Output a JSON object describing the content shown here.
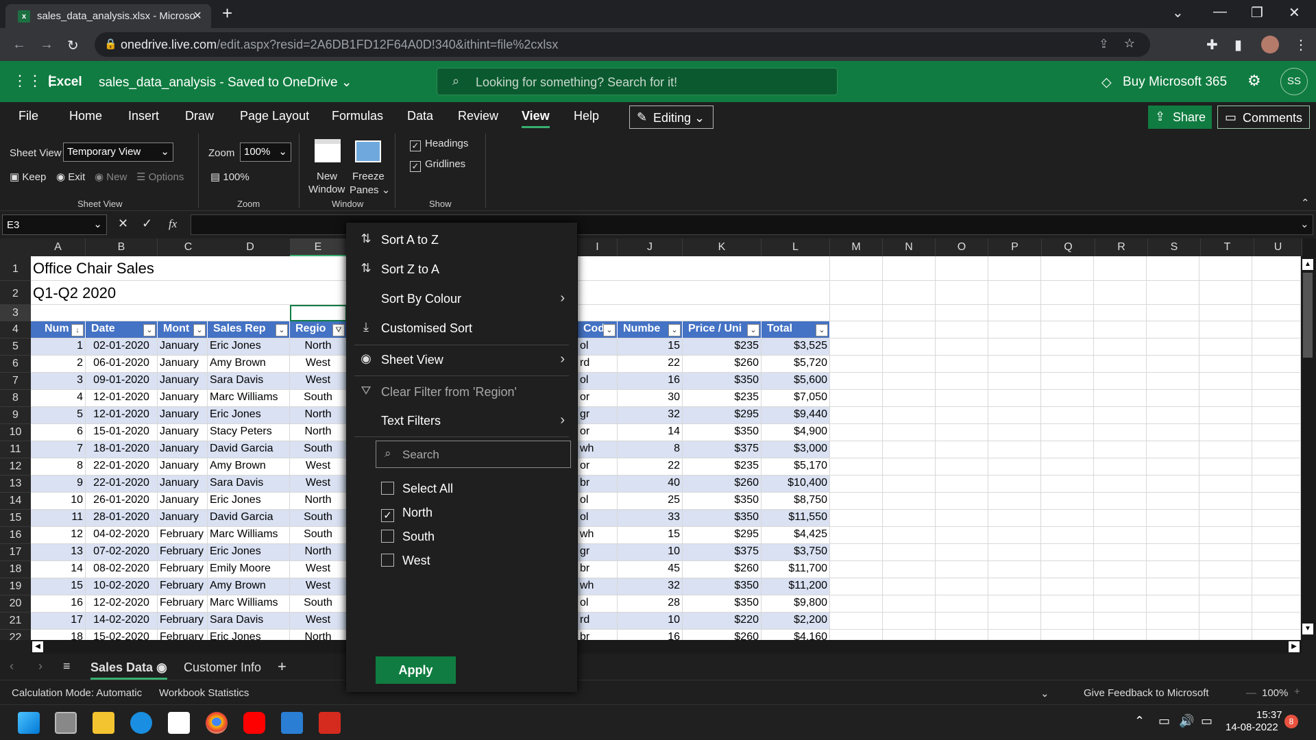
{
  "browser": {
    "tab_title": "sales_data_analysis.xlsx - Microso",
    "url_host": "onedrive.live.com",
    "url_path": "/edit.aspx?resid=2A6DB1FD12F64A0D!340&ithint=file%2cxlsx"
  },
  "header": {
    "app_name": "Excel",
    "doc_title": "sales_data_analysis  -  Saved to OneDrive ⌄",
    "search_placeholder": "Looking for something? Search for it!",
    "buy_label": "Buy Microsoft 365",
    "avatar_initials": "SS"
  },
  "menu": {
    "items": [
      "File",
      "Home",
      "Insert",
      "Draw",
      "Page Layout",
      "Formulas",
      "Data",
      "Review",
      "View",
      "Help"
    ],
    "editing": "Editing",
    "share": "Share",
    "comments": "Comments"
  },
  "ribbon": {
    "sheet_view_label": "Sheet View",
    "sheet_view_value": "Temporary View",
    "keep": "Keep",
    "exit": "Exit",
    "new": "New",
    "options": "Options",
    "group_sheet_view": "Sheet View",
    "zoom_label": "Zoom",
    "zoom_value": "100%",
    "zoom_100": "100%",
    "group_zoom": "Zoom",
    "new_window_1": "New",
    "new_window_2": "Window",
    "freeze_1": "Freeze",
    "freeze_2": "Panes ⌄",
    "group_window": "Window",
    "headings": "Headings",
    "gridlines": "Gridlines",
    "group_show": "Show"
  },
  "formula_bar": {
    "name_box": "E3",
    "fx": "fx"
  },
  "grid": {
    "columns": [
      "A",
      "B",
      "C",
      "D",
      "E",
      "",
      "",
      "",
      "I",
      "J",
      "K",
      "L",
      "M",
      "N",
      "O",
      "P",
      "Q",
      "R",
      "S",
      "T",
      "U"
    ],
    "rows": [
      "1",
      "2",
      "3",
      "4",
      "5",
      "6",
      "7",
      "8",
      "9",
      "10",
      "11",
      "12",
      "13",
      "14",
      "15",
      "16",
      "17",
      "18",
      "19",
      "20",
      "21",
      "22"
    ],
    "title1": "Office Chair Sales",
    "title2": "Q1-Q2 2020",
    "headers": [
      "Num",
      "Date",
      "Mont",
      "Sales Rep",
      "Regio",
      "Cod",
      "Numbe",
      "Price / Uni",
      "Total"
    ],
    "data": [
      [
        "1",
        "02-01-2020",
        "January",
        "Eric Jones",
        "North",
        "ol",
        "15",
        "$235",
        "$3,525"
      ],
      [
        "2",
        "06-01-2020",
        "January",
        "Amy Brown",
        "West",
        "rd",
        "22",
        "$260",
        "$5,720"
      ],
      [
        "3",
        "09-01-2020",
        "January",
        "Sara Davis",
        "West",
        "ol",
        "16",
        "$350",
        "$5,600"
      ],
      [
        "4",
        "12-01-2020",
        "January",
        "Marc Williams",
        "South",
        "or",
        "30",
        "$235",
        "$7,050"
      ],
      [
        "5",
        "12-01-2020",
        "January",
        "Eric Jones",
        "North",
        "gr",
        "32",
        "$295",
        "$9,440"
      ],
      [
        "6",
        "15-01-2020",
        "January",
        "Stacy Peters",
        "North",
        "or",
        "14",
        "$350",
        "$4,900"
      ],
      [
        "7",
        "18-01-2020",
        "January",
        "David Garcia",
        "South",
        "wh",
        "8",
        "$375",
        "$3,000"
      ],
      [
        "8",
        "22-01-2020",
        "January",
        "Amy Brown",
        "West",
        "or",
        "22",
        "$235",
        "$5,170"
      ],
      [
        "9",
        "22-01-2020",
        "January",
        "Sara Davis",
        "West",
        "br",
        "40",
        "$260",
        "$10,400"
      ],
      [
        "10",
        "26-01-2020",
        "January",
        "Eric Jones",
        "North",
        "ol",
        "25",
        "$350",
        "$8,750"
      ],
      [
        "11",
        "28-01-2020",
        "January",
        "David Garcia",
        "South",
        "ol",
        "33",
        "$350",
        "$11,550"
      ],
      [
        "12",
        "04-02-2020",
        "February",
        "Marc Williams",
        "South",
        "wh",
        "15",
        "$295",
        "$4,425"
      ],
      [
        "13",
        "07-02-2020",
        "February",
        "Eric Jones",
        "North",
        "gr",
        "10",
        "$375",
        "$3,750"
      ],
      [
        "14",
        "08-02-2020",
        "February",
        "Emily Moore",
        "West",
        "br",
        "45",
        "$260",
        "$11,700"
      ],
      [
        "15",
        "10-02-2020",
        "February",
        "Amy Brown",
        "West",
        "wh",
        "32",
        "$350",
        "$11,200"
      ],
      [
        "16",
        "12-02-2020",
        "February",
        "Marc Williams",
        "South",
        "ol",
        "28",
        "$350",
        "$9,800"
      ],
      [
        "17",
        "14-02-2020",
        "February",
        "Sara Davis",
        "West",
        "rd",
        "10",
        "$220",
        "$2,200"
      ],
      [
        "18",
        "15-02-2020",
        "February",
        "Eric Jones",
        "North",
        "br",
        "16",
        "$260",
        "$4,160"
      ]
    ]
  },
  "filter_menu": {
    "sort_az": "Sort A to Z",
    "sort_za": "Sort Z to A",
    "sort_colour": "Sort By Colour",
    "custom_sort": "Customised Sort",
    "sheet_view": "Sheet View",
    "clear_filter": "Clear Filter from 'Region'",
    "text_filters": "Text Filters",
    "search_placeholder": "Search",
    "select_all": "Select All",
    "north": "North",
    "south": "South",
    "west": "West",
    "apply": "Apply"
  },
  "sheets": {
    "active": "Sales Data",
    "other": "Customer Info"
  },
  "status": {
    "calc_mode": "Calculation Mode: Automatic",
    "workbook_stats": "Workbook Statistics",
    "feedback": "Give Feedback to Microsoft",
    "zoom": "100%"
  },
  "taskbar": {
    "time": "15:37",
    "date": "14-08-2022",
    "badge": "8"
  }
}
